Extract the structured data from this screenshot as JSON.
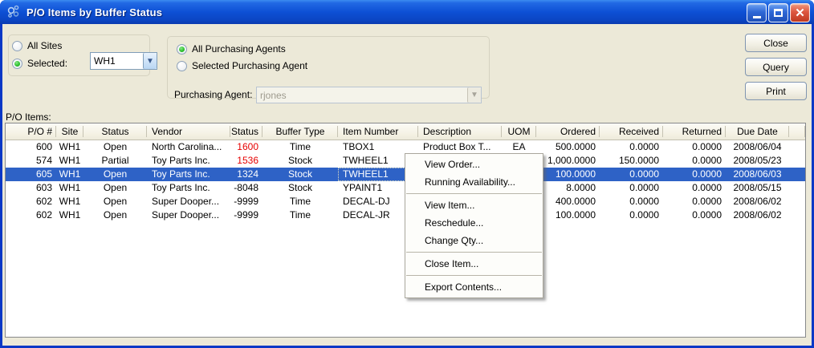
{
  "colors": {
    "selection_blue": "#2e62c6",
    "alert_red": "#e60000",
    "titlebar_blue": "#0d50d5",
    "dialog_background": "#ece9d8"
  },
  "titlebar": {
    "title": "P/O Items by Buffer Status"
  },
  "filters": {
    "sites": {
      "all_label": "All Sites",
      "selected_label": "Selected:",
      "selected_site": "WH1"
    },
    "agents": {
      "all_label": "All Purchasing Agents",
      "selected_label": "Selected Purchasing Agent",
      "field_label": "Purchasing Agent:",
      "agent": "rjones"
    }
  },
  "buttons": {
    "close": "Close",
    "query": "Query",
    "print": "Print"
  },
  "list": {
    "caption": "P/O Items:",
    "columns": [
      "P/O #",
      "Site",
      "Status",
      "Vendor",
      "Status",
      "Buffer Type",
      "Item Number",
      "Description",
      "UOM",
      "Ordered",
      "Received",
      "Returned",
      "Due Date"
    ],
    "rows": [
      {
        "cells": [
          "600",
          "WH1",
          "Open",
          "North Carolina...",
          "1600",
          "Time",
          "TBOX1",
          "Product Box T...",
          "EA",
          "500.0000",
          "0.0000",
          "0.0000",
          "2008/06/04"
        ],
        "status_red": true,
        "selected": false
      },
      {
        "cells": [
          "574",
          "WH1",
          "Partial",
          "Toy Parts Inc.",
          "1536",
          "Stock",
          "TWHEEL1",
          "",
          "",
          "1,000.0000",
          "150.0000",
          "0.0000",
          "2008/05/23"
        ],
        "status_red": true,
        "selected": false
      },
      {
        "cells": [
          "605",
          "WH1",
          "Open",
          "Toy Parts Inc.",
          "1324",
          "Stock",
          "TWHEEL1",
          "",
          "",
          "100.0000",
          "0.0000",
          "0.0000",
          "2008/06/03"
        ],
        "status_red": false,
        "selected": true
      },
      {
        "cells": [
          "603",
          "WH1",
          "Open",
          "Toy Parts Inc.",
          "-8048",
          "Stock",
          "YPAINT1",
          "",
          "",
          "8.0000",
          "0.0000",
          "0.0000",
          "2008/05/15"
        ],
        "status_red": false,
        "selected": false
      },
      {
        "cells": [
          "602",
          "WH1",
          "Open",
          "Super Dooper...",
          "-9999",
          "Time",
          "DECAL-DJ",
          "",
          "",
          "400.0000",
          "0.0000",
          "0.0000",
          "2008/06/02"
        ],
        "status_red": false,
        "selected": false
      },
      {
        "cells": [
          "602",
          "WH1",
          "Open",
          "Super Dooper...",
          "-9999",
          "Time",
          "DECAL-JR",
          "",
          "",
          "100.0000",
          "0.0000",
          "0.0000",
          "2008/06/02"
        ],
        "status_red": false,
        "selected": false
      }
    ]
  },
  "context_menu": {
    "items": [
      "View Order...",
      "Running Availability...",
      "--",
      "View Item...",
      "Reschedule...",
      "Change Qty...",
      "--",
      "Close Item...",
      "--",
      "Export Contents..."
    ]
  }
}
